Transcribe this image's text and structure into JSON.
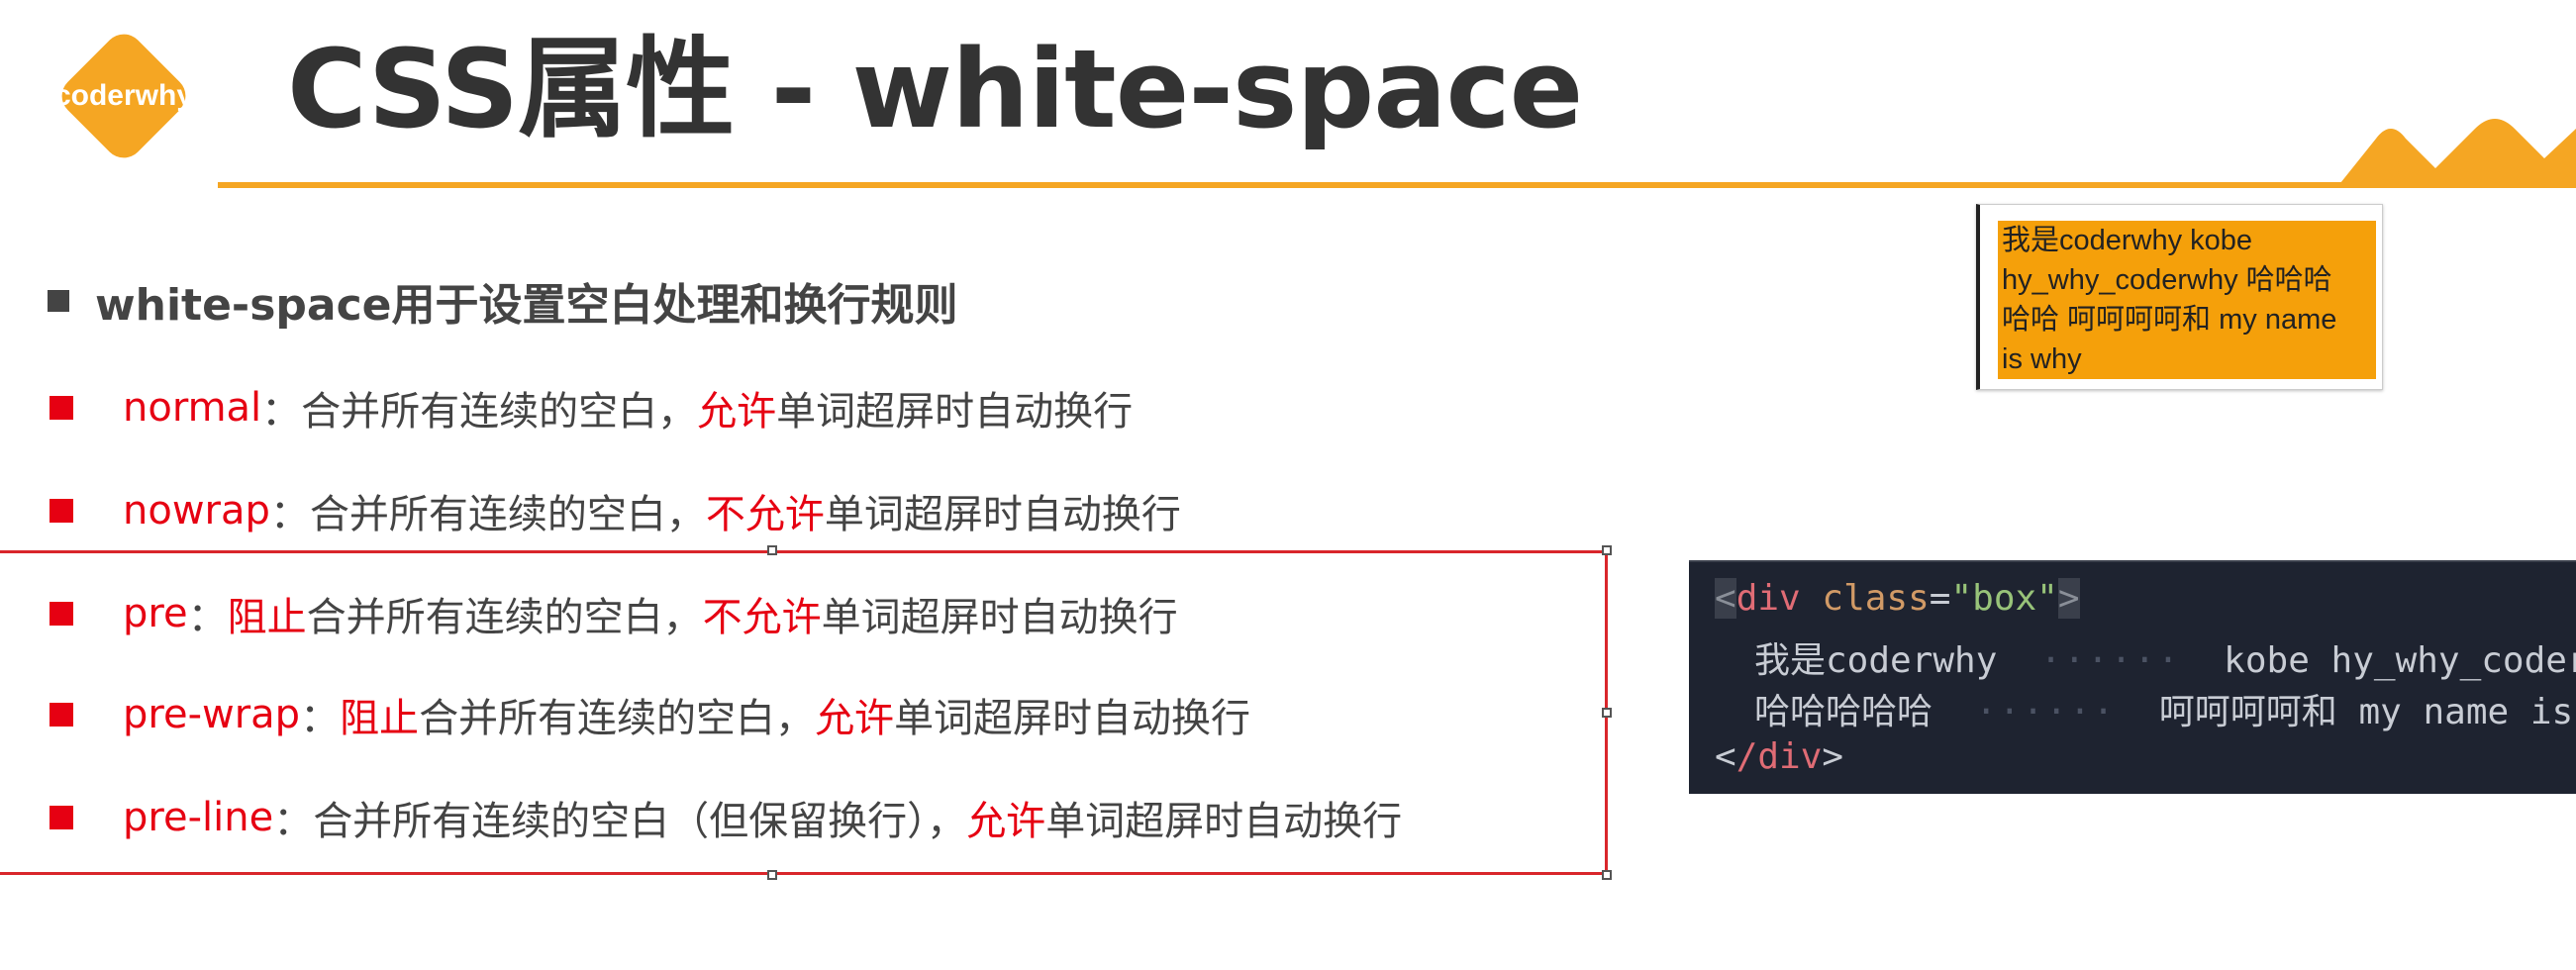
{
  "header": {
    "logo_text": "coderwhy",
    "title": "CSS属性 - white-space"
  },
  "heading": "white-space用于设置空白处理和换行规则",
  "items": [
    {
      "keyword": "normal",
      "sep": "：",
      "parts": [
        "合并所有连续的空白，",
        "允许",
        "单词超屏时自动换行"
      ]
    },
    {
      "keyword": "nowrap",
      "sep": "：",
      "parts": [
        "合并所有连续的空白，",
        "不允许",
        "单词超屏时自动换行"
      ]
    },
    {
      "keyword": "pre",
      "sep": "：",
      "parts": [
        "阻止",
        "合并所有连续的空白，",
        "不允许",
        "单词超屏时自动换行"
      ]
    },
    {
      "keyword": "pre-wrap",
      "sep": "：",
      "parts": [
        "阻止",
        "合并所有连续的空白，",
        "允许",
        "单词超屏时自动换行"
      ]
    },
    {
      "keyword": "pre-line",
      "sep": "：",
      "parts": [
        "合并所有连续的空白（但保留换行），",
        "允许",
        "单词超屏时自动换行"
      ]
    }
  ],
  "demo": {
    "lines": [
      "我是coderwhy kobe",
      "hy_why_coderwhy 哈哈哈",
      "哈哈 呵呵呵呵和 my name",
      "is why"
    ]
  },
  "code": {
    "tag": "div",
    "attr": "class",
    "value": "\"box\"",
    "line2_text": "我是coderwhy",
    "line2_dots": "······",
    "line2_rest": "kobe hy_why_coderwh",
    "line3_text": "哈哈哈哈哈",
    "line3_dots": "······",
    "line3_rest": "呵呵呵呵和 my name is",
    "close_tag": "/div"
  },
  "colors": {
    "accent_orange": "#f5a623",
    "keyword_red": "#e60012",
    "selection_border": "#d9262b"
  }
}
